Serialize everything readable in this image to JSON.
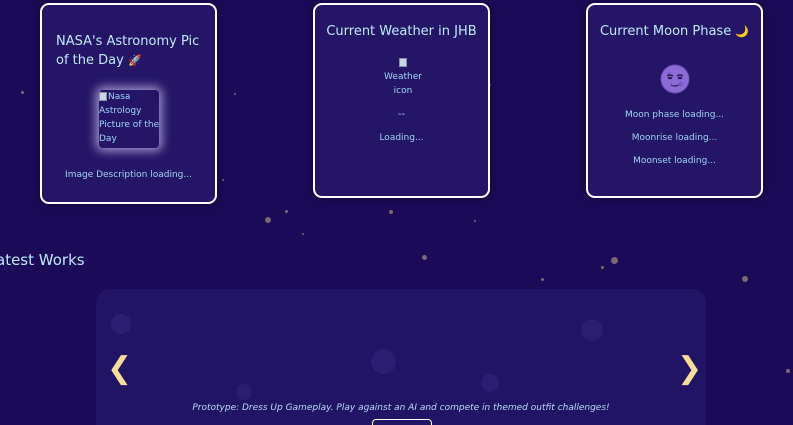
{
  "cards": {
    "nasa": {
      "title": "NASA's Astronomy Pic of the Day",
      "title_emoji": "🚀",
      "image_alt": "Nasa Astrology Picture of the Day",
      "description": "Image Description loading..."
    },
    "weather": {
      "title": "Current Weather in JHB",
      "icon_alt": "Weather icon",
      "temperature": "--",
      "status": "Loading..."
    },
    "moon": {
      "title": "Current Moon Phase",
      "title_emoji": "🌙",
      "face_icon": "moon-face-icon",
      "phase": "Moon phase loading...",
      "moonrise": "Moonrise loading...",
      "moonset": "Moonset loading..."
    }
  },
  "latest_works": {
    "heading": "atest Works",
    "caption": "Prototype: Dress Up Gameplay. Play against an AI and compete in themed outfit challenges!",
    "prev_arrow": "❮",
    "next_arrow": "❯"
  },
  "colors": {
    "background": "#1b0a57",
    "card": "#241566",
    "accent_text": "#bfe9ff",
    "arrow": "#f6dd9a"
  }
}
